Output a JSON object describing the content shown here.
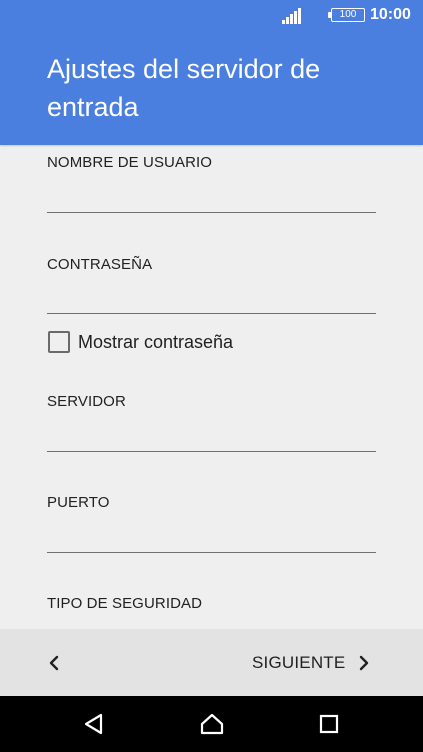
{
  "status_bar": {
    "battery_level": "100",
    "time": "10:00",
    "icons": [
      "signal-icon",
      "battery-icon"
    ]
  },
  "app_bar": {
    "title": "Ajustes del servidor de entrada",
    "background_color": "#4a7fe0"
  },
  "form": {
    "username_label": "NOMBRE DE USUARIO",
    "username_value": "",
    "password_label": "CONTRASEÑA",
    "password_value": "",
    "show_password_label": "Mostrar contraseña",
    "show_password_checked": false,
    "server_label": "SERVIDOR",
    "server_value": "",
    "port_label": "PUERTO",
    "port_value": "",
    "security_label": "TIPO DE SEGURIDAD"
  },
  "bottom_nav": {
    "next_label": "SIGUIENTE",
    "icons": [
      "chevron-left-icon",
      "chevron-right-icon"
    ]
  },
  "system_nav": {
    "icons": [
      "back-triangle-icon",
      "home-icon",
      "recents-square-icon"
    ]
  }
}
